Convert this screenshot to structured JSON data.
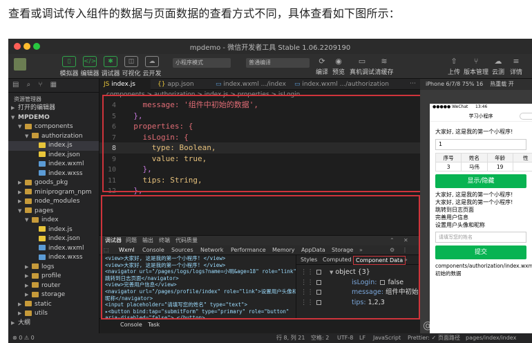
{
  "caption": "查看或调试传入组件的数据与页面数据的查看方式不同，具体查看如下图所示：",
  "window": {
    "title": "mpdemo - 微信开发者工具 Stable 1.06.2209190"
  },
  "toolbar": {
    "left_buttons": [
      "模拟器",
      "编辑器",
      "调试器",
      "可视化",
      "云开发"
    ],
    "mode_select": "小程序模式",
    "compile_select": "普通编译",
    "right_buttons": [
      "编译",
      "预览",
      "真机调试",
      "清缓存"
    ],
    "far_right": [
      "上传",
      "版本管理",
      "云测",
      "详情"
    ]
  },
  "sidebar": {
    "header": "资源管理器",
    "open_editors": "打开的编辑器",
    "project": "MPDEMO",
    "tree": [
      {
        "label": "components",
        "depth": 1,
        "type": "folder",
        "open": true
      },
      {
        "label": "authorization",
        "depth": 2,
        "type": "folder",
        "open": true
      },
      {
        "label": "index.js",
        "depth": 3,
        "type": "js",
        "selected": true
      },
      {
        "label": "index.json",
        "depth": 3,
        "type": "json"
      },
      {
        "label": "index.wxml",
        "depth": 3,
        "type": "wxml"
      },
      {
        "label": "index.wxss",
        "depth": 3,
        "type": "wxss"
      },
      {
        "label": "goods_pkg",
        "depth": 1,
        "type": "folder"
      },
      {
        "label": "miniprogram_npm",
        "depth": 1,
        "type": "folder"
      },
      {
        "label": "node_modules",
        "depth": 1,
        "type": "folder"
      },
      {
        "label": "pages",
        "depth": 1,
        "type": "folder",
        "open": true
      },
      {
        "label": "index",
        "depth": 2,
        "type": "folder",
        "open": true
      },
      {
        "label": "index.js",
        "depth": 3,
        "type": "js"
      },
      {
        "label": "index.json",
        "depth": 3,
        "type": "json"
      },
      {
        "label": "index.wxml",
        "depth": 3,
        "type": "wxml"
      },
      {
        "label": "index.wxss",
        "depth": 3,
        "type": "wxss"
      },
      {
        "label": "logs",
        "depth": 2,
        "type": "folder"
      },
      {
        "label": "profile",
        "depth": 2,
        "type": "folder"
      },
      {
        "label": "router",
        "depth": 2,
        "type": "folder"
      },
      {
        "label": "storage",
        "depth": 2,
        "type": "folder"
      },
      {
        "label": "static",
        "depth": 1,
        "type": "folder"
      },
      {
        "label": "utils",
        "depth": 1,
        "type": "folder"
      },
      {
        "label": "大纲",
        "depth": 0,
        "type": "section"
      }
    ]
  },
  "editor": {
    "tabs": [
      "index.js",
      "app.json",
      "index.wxml .../index",
      "index.wxml .../authorization"
    ],
    "breadcrumb": "components > authorization > index.js > properties > isLogin",
    "lines": [
      {
        "n": "4",
        "text": "    message: '组件中初始的数据',"
      },
      {
        "n": "5",
        "text": "  },"
      },
      {
        "n": "6",
        "text": "  properties: {"
      },
      {
        "n": "7",
        "text": "    isLogin: {"
      },
      {
        "n": "8",
        "text": "      type: Boolean,"
      },
      {
        "n": "9",
        "text": "      value: true,"
      },
      {
        "n": "10",
        "text": "    },"
      },
      {
        "n": "11",
        "text": "    tips: String,"
      },
      {
        "n": "12",
        "text": "  },"
      }
    ]
  },
  "devtools": {
    "top_tabs": [
      "调试器",
      "问题",
      "输出",
      "终端",
      "代码质量"
    ],
    "sub_tabs": [
      "Wxml",
      "Console",
      "Sources",
      "Network",
      "Performance",
      "Memory",
      "AppData",
      "Storage"
    ],
    "wxml_lines": [
      "<view>大家好, 这是我的第一个小程序! </view>",
      "<view>大家好, 这是我的第一个小程序! </view>",
      "<navigator url=\"/pages/logs/logs?name=小明&age=18\" role=\"link\">",
      "跳转到日志页面</navigator>",
      "<view>完善用户信息</view>",
      "<navigator url=\"/pages/profile/index\" role=\"link\">设置用户头像和",
      "昵称</navigator>",
      "<input placeholder=\"请填写您的姓名\" type=\"text\">",
      "▸<button bind:tap=\"submitForm\" type=\"primary\" role=\"button\"",
      "aria-disabled=\"false\">…</button>",
      "▸<authorization is=\"components/authorization/index\">…",
      "</authorization>",
      "</page>"
    ],
    "wxml_breadcrumb": [
      "page",
      "authorization"
    ],
    "right_tabs": [
      "Styles",
      "Computed",
      "Component Data"
    ],
    "component_data": {
      "object_label": "object {3}",
      "rows": [
        {
          "key": "isLogin",
          "value": "false",
          "checkbox": true
        },
        {
          "key": "message",
          "value": "组件中初始的数据"
        },
        {
          "key": "tips",
          "value": "1,2,3"
        }
      ]
    }
  },
  "bottom_tabs": [
    "Console",
    "Task"
  ],
  "statusbar": {
    "left": "⊗ 0 ⚠ 0",
    "position": "行 8, 列 21",
    "spaces": "空格: 2",
    "encoding": "UTF-8",
    "eol": "LF",
    "language": "JavaScript",
    "prettier": "Prettier: ✓",
    "page_path_label": "页面路径",
    "page_path": "pages/index/index"
  },
  "simulator": {
    "device": "iPhone 6/7/8 75% 16",
    "hot_reload": "热重载 开",
    "status_left": "●●●●● WeChat",
    "status_time": "13:46",
    "nav_title": "学习小程序",
    "texts": [
      "大家好, 这是我的第一个小程序!"
    ],
    "input_value": "1",
    "table_header": [
      "序号",
      "姓名",
      "年龄",
      "性"
    ],
    "table_row": [
      "3",
      "马伟",
      "19",
      ""
    ],
    "toggle_button": "显示/隐藏",
    "lines": [
      "大家好, 这是我的第一个小程序!",
      "大家好, 这是我的第一个小程序!",
      "跳转到日志页面",
      "完善用户信息",
      "设置用户头像和昵称"
    ],
    "name_placeholder": "请填写您的姓名",
    "submit_button": "提交",
    "component_path": "components/authorization/index.wxml",
    "component_text": "初始的数据"
  },
  "watermark": "@稀土掘金技术社区",
  "colors": {
    "accent": "#2fa74b",
    "red_box": "#d0343b",
    "wechat_green": "#08b352"
  }
}
